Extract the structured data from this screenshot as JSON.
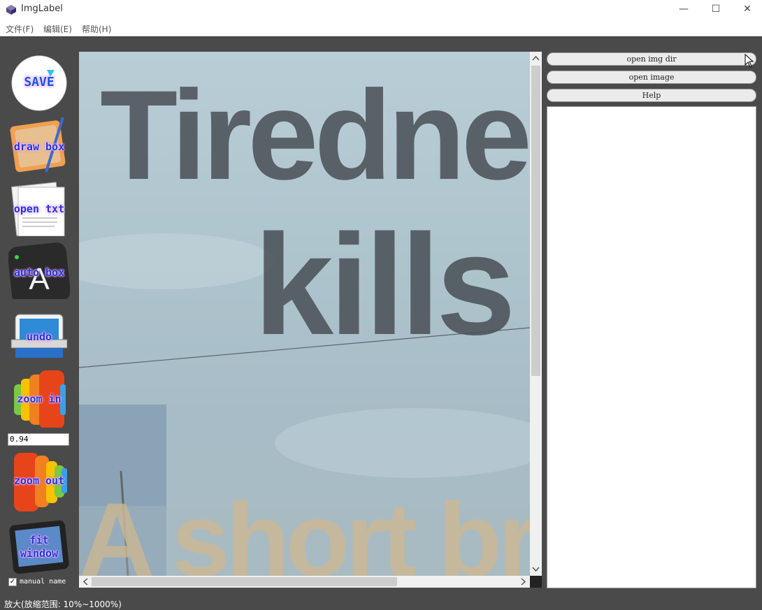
{
  "window": {
    "title": "ImgLabel",
    "minimize_glyph": "—",
    "maximize_glyph": "☐",
    "close_glyph": "✕"
  },
  "menu": [
    "文件(F)",
    "编辑(E)",
    "帮助(H)"
  ],
  "toolbar": {
    "save_label": "SAVE",
    "draw_box_label": "draw box",
    "open_txt_label": "open txt",
    "auto_box_label": "auto box",
    "undo_label": "undo",
    "zoom_in_label": "zoom in",
    "zoom_value": "0.94",
    "zoom_out_label": "zoom out",
    "fit_window_label_1": "fit",
    "fit_window_label_2": "window",
    "manual_name_label": "manual name",
    "manual_name_checked": true
  },
  "image": {
    "line1": "Tiredne",
    "line2": "kills",
    "line3": "A short bre"
  },
  "right_panel": {
    "open_img_dir": "open img dir",
    "open_image": "open image",
    "help": "Help"
  },
  "status": "放大(放缩范围: 10%~1000%)",
  "colors": {
    "accent_text": "#2233dd",
    "background": "#4a4a4a"
  }
}
